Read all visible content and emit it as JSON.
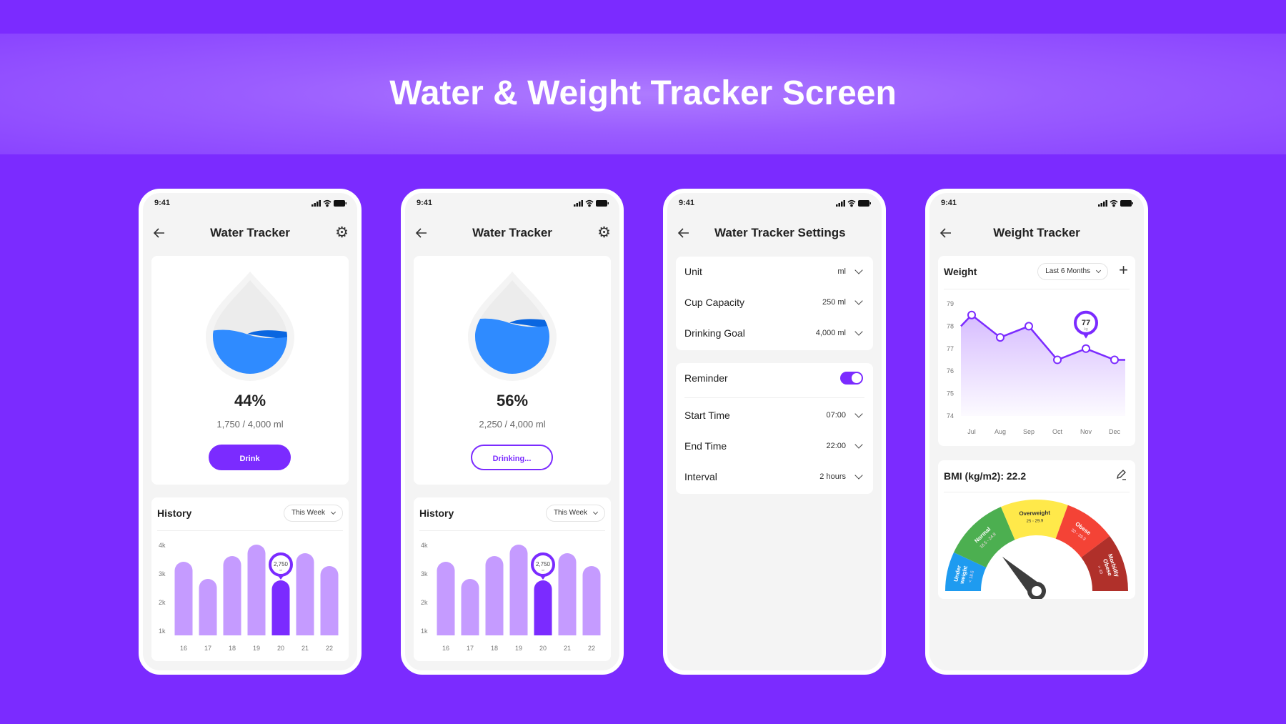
{
  "page_title": "Water & Weight Tracker Screen",
  "status_time": "9:41",
  "colors": {
    "background": "#7B2BFF",
    "accent": "#7B2BFF",
    "bar": "#C59BFF",
    "water": "#2F8BFF",
    "water_dark": "#0A66E0"
  },
  "water_screens": [
    {
      "title": "Water Tracker",
      "percent": "44%",
      "fill_percent": 44,
      "amount": "1,750 / 4,000 ml",
      "button": "Drink",
      "button_state": "default",
      "history": {
        "title": "History",
        "filter": "This Week"
      }
    },
    {
      "title": "Water Tracker",
      "percent": "56%",
      "fill_percent": 56,
      "amount": "2,250 / 4,000 ml",
      "button": "Drinking...",
      "button_state": "active",
      "history": {
        "title": "History",
        "filter": "This Week"
      }
    }
  ],
  "settings": {
    "title": "Water Tracker Settings",
    "group1": [
      {
        "label": "Unit",
        "value": "ml"
      },
      {
        "label": "Cup Capacity",
        "value": "250 ml"
      },
      {
        "label": "Drinking Goal",
        "value": "4,000 ml"
      }
    ],
    "reminder": {
      "label": "Reminder",
      "on": true
    },
    "group2": [
      {
        "label": "Start Time",
        "value": "07:00"
      },
      {
        "label": "End Time",
        "value": "22:00"
      },
      {
        "label": "Interval",
        "value": "2 hours"
      }
    ]
  },
  "weight": {
    "title": "Weight Tracker",
    "card_title": "Weight",
    "filter": "Last 6 Months",
    "bmi_title": "BMI (kg/m2): 22.2",
    "bmi_value": 22.2,
    "bmi_categories": [
      {
        "lines": [
          "Under",
          "weight"
        ],
        "range": "< 18.5",
        "color": "#1E9BF0"
      },
      {
        "lines": [
          "Normal"
        ],
        "range": "18.5 - 24.9",
        "color": "#4CAF50"
      },
      {
        "lines": [
          "Overweight"
        ],
        "range": "25 - 29.9",
        "color": "#FFE94A"
      },
      {
        "lines": [
          "Obese"
        ],
        "range": "30 - 39.9",
        "color": "#F44336"
      },
      {
        "lines": [
          "Morbidly",
          "Obese"
        ],
        "range": "> 40",
        "color": "#B0302A"
      }
    ]
  },
  "chart_data": [
    {
      "type": "bar",
      "categories": [
        "16",
        "17",
        "18",
        "19",
        "20",
        "21",
        "22"
      ],
      "values": [
        3400,
        2800,
        3600,
        4000,
        2750,
        3700,
        3250
      ],
      "y_ticks": [
        "4k",
        "3k",
        "2k",
        "1k"
      ],
      "highlight": "20",
      "tooltip": "2,750",
      "tooltip_unit": "ml"
    },
    {
      "type": "bar",
      "categories": [
        "16",
        "17",
        "18",
        "19",
        "20",
        "21",
        "22"
      ],
      "values": [
        3400,
        2800,
        3600,
        4000,
        2750,
        3700,
        3250
      ],
      "y_ticks": [
        "4k",
        "3k",
        "2k",
        "1k"
      ],
      "highlight": "20",
      "tooltip": "2,750",
      "tooltip_unit": "ml"
    },
    {
      "type": "area",
      "categories": [
        "Jul",
        "Aug",
        "Sep",
        "Oct",
        "Nov",
        "Dec"
      ],
      "values": [
        78.5,
        77.5,
        78,
        76.5,
        77,
        76.5
      ],
      "y_ticks": [
        "79",
        "78",
        "77",
        "76",
        "75",
        "74"
      ],
      "ylim": [
        74,
        79
      ],
      "highlight": "Nov",
      "tooltip": "77",
      "tooltip_unit": "kg"
    }
  ]
}
